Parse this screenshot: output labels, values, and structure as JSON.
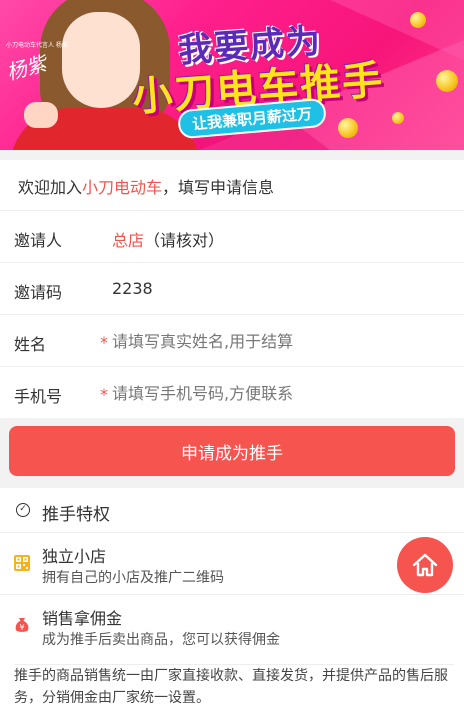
{
  "banner": {
    "signature_small": "小刀电动车代言人 杨紫",
    "signature": "杨紫",
    "title_line1": "我要成为",
    "title_line2": "小刀电车推手",
    "slogan": "让我兼职月薪过万"
  },
  "form": {
    "intro_prefix": "欢迎加入",
    "intro_brand": "小刀电动车",
    "intro_suffix": "，填写申请信息",
    "inviter": {
      "label": "邀请人",
      "value": "总店",
      "note": "（请核对）"
    },
    "invite_code": {
      "label": "邀请码",
      "value": "2238"
    },
    "name": {
      "label": "姓名",
      "required_mark": "*",
      "placeholder": "请填写真实姓名,用于结算"
    },
    "phone": {
      "label": "手机号",
      "required_mark": "*",
      "placeholder": "请填写手机号码,方便联系"
    }
  },
  "submit": {
    "label": "申请成为推手"
  },
  "privileges": {
    "title": "推手特权",
    "items": [
      {
        "title": "独立小店",
        "desc": "拥有自己的小店及推广二维码",
        "icon": "qrcode-icon"
      },
      {
        "title": "销售拿佣金",
        "desc": "成为推手后卖出商品，您可以获得佣金",
        "icon": "money-bag-icon"
      }
    ],
    "note": "推手的商品销售统一由厂家直接收款、直接发货，并提供产品的售后服务，分销佣金由厂家统一设置。"
  },
  "fab": {
    "icon": "home-icon"
  },
  "colors": {
    "accent": "#f6554f",
    "banner": "#ff1f8c"
  }
}
